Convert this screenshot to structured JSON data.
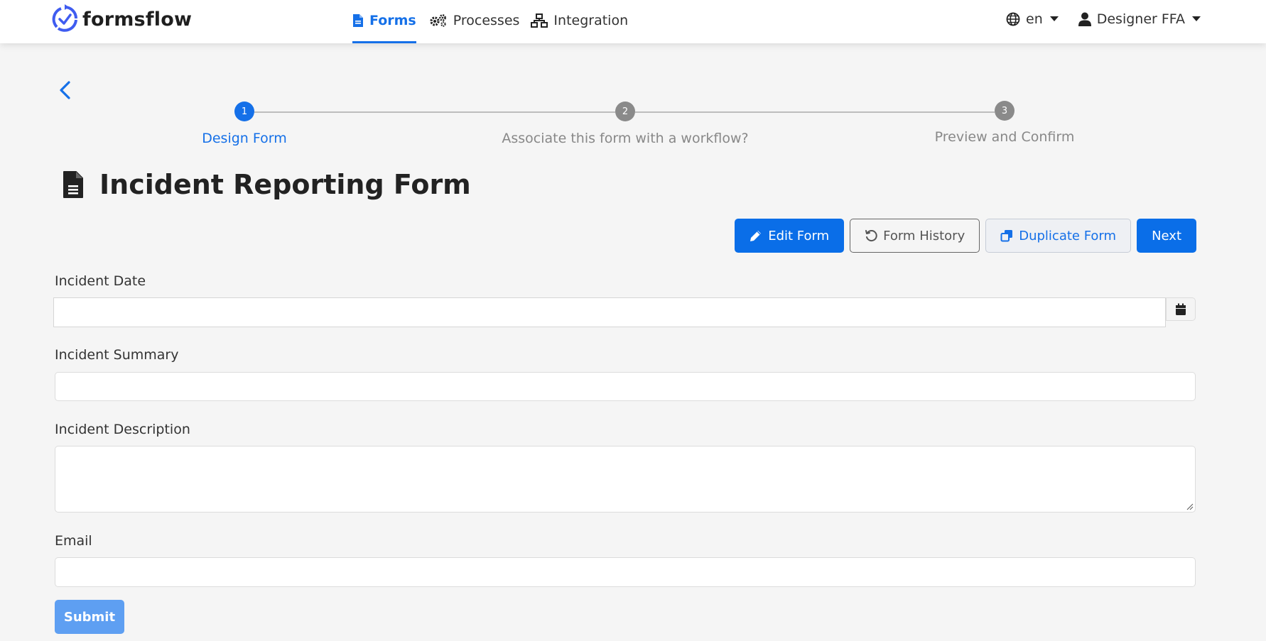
{
  "app": {
    "brand": "formsflow"
  },
  "nav": {
    "forms": "Forms",
    "processes": "Processes",
    "integration": "Integration"
  },
  "header": {
    "language": "en",
    "user": "Designer FFA"
  },
  "stepper": {
    "steps": [
      {
        "number": "1",
        "label": "Design Form",
        "state": "active"
      },
      {
        "number": "2",
        "label": "Associate this form with a workflow?",
        "state": "inactive"
      },
      {
        "number": "3",
        "label": "Preview and Confirm",
        "state": "inactive"
      }
    ]
  },
  "page": {
    "title": "Incident Reporting Form"
  },
  "actions": {
    "edit": "Edit Form",
    "history": "Form History",
    "duplicate": "Duplicate Form",
    "next": "Next"
  },
  "form": {
    "fields": [
      {
        "label": "Incident Date",
        "value": "",
        "type": "date"
      },
      {
        "label": "Incident Summary",
        "value": "",
        "type": "text"
      },
      {
        "label": "Incident Description",
        "value": "",
        "type": "textarea"
      },
      {
        "label": "Email",
        "value": "",
        "type": "email"
      }
    ],
    "submit": "Submit"
  },
  "colors": {
    "primary": "#0a6ee8",
    "step_active": "#1570e8",
    "step_inactive": "#8a8a8a",
    "submit_disabled": "#5e9ff2"
  }
}
